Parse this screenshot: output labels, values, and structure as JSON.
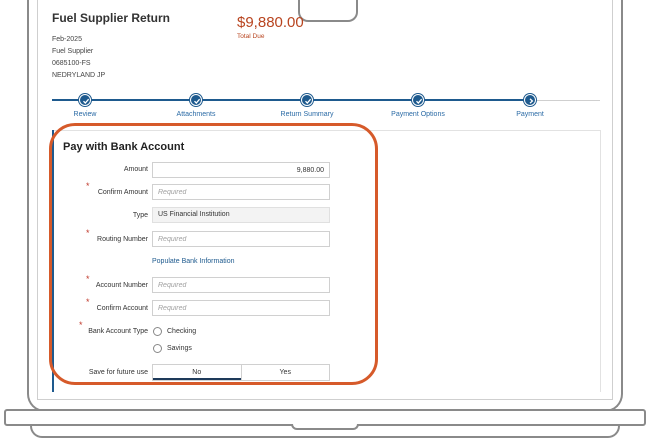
{
  "header": {
    "title": "Fuel Supplier Return",
    "period": "Feb-2025",
    "account_type": "Fuel Supplier",
    "account_id": "0685100-FS",
    "name": "NEDRYLAND JP",
    "total_amount": "$9,880.00",
    "total_label": "Total Due"
  },
  "stepper": {
    "steps": [
      {
        "label": "Review",
        "status": "complete"
      },
      {
        "label": "Attachments",
        "status": "complete"
      },
      {
        "label": "Return Summary",
        "status": "complete"
      },
      {
        "label": "Payment Options",
        "status": "complete"
      },
      {
        "label": "Payment",
        "status": "current"
      }
    ]
  },
  "form": {
    "title": "Pay with Bank Account",
    "amount": {
      "label": "Amount",
      "value": "9,880.00"
    },
    "confirm_amount": {
      "label": "Confirm Amount",
      "placeholder": "Required"
    },
    "type": {
      "label": "Type",
      "value": "US Financial Institution"
    },
    "routing_number": {
      "label": "Routing Number",
      "placeholder": "Required"
    },
    "populate_link": "Populate Bank Information",
    "account_number": {
      "label": "Account Number",
      "placeholder": "Required"
    },
    "confirm_account": {
      "label": "Confirm Account",
      "placeholder": "Required"
    },
    "bank_account_type": {
      "label": "Bank Account Type",
      "options": [
        "Checking",
        "Savings"
      ]
    },
    "save_future": {
      "label": "Save for future use",
      "options": [
        "No",
        "Yes"
      ],
      "selected": "No"
    },
    "required_marker": "*"
  },
  "colors": {
    "primary": "#1e5a8e",
    "accent": "#b8441f",
    "highlight": "#d65a2a",
    "required": "#c0392b"
  }
}
